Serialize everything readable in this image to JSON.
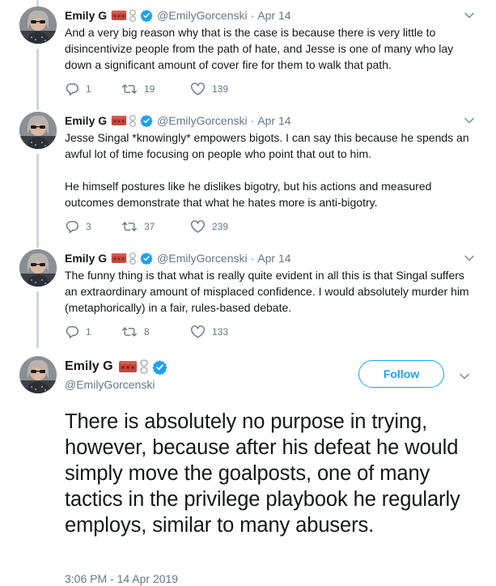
{
  "colors": {
    "accent": "#1da1f2",
    "muted": "#657786",
    "text": "#14171a",
    "thread_line": "#ccd6dd"
  },
  "icons": [
    "brick-icon",
    "chain-icon",
    "verified-badge-icon",
    "chevron-down-icon",
    "reply-icon",
    "retweet-icon",
    "like-icon"
  ],
  "thread": [
    {
      "name": "Emily G",
      "handle": "@EmilyGorcenski",
      "separator": "·",
      "date": "Apr 14",
      "paragraphs": [
        "And a very big reason why that is the case is because there is very little to disincentivize people from the path of hate, and Jesse is one of many who lay down a significant amount of cover fire for them to walk that path."
      ],
      "replies": "1",
      "retweets": "19",
      "likes": "139"
    },
    {
      "name": "Emily G",
      "handle": "@EmilyGorcenski",
      "separator": "·",
      "date": "Apr 14",
      "paragraphs": [
        "Jesse Singal *knowingly* empowers bigots. I can say this because he spends an awful lot of time focusing on people who point that out to him.",
        "He himself postures like he dislikes bigotry, but his actions and measured outcomes demonstrate that what he hates more is anti-bigotry."
      ],
      "replies": "3",
      "retweets": "37",
      "likes": "239"
    },
    {
      "name": "Emily G",
      "handle": "@EmilyGorcenski",
      "separator": "·",
      "date": "Apr 14",
      "paragraphs": [
        "The funny thing is that what is really quite evident in all this is that Singal suffers an extraordinary amount of misplaced confidence. I would absolutely murder him (metaphorically) in a fair, rules-based debate."
      ],
      "replies": "1",
      "retweets": "8",
      "likes": "133"
    }
  ],
  "main_tweet": {
    "name": "Emily G",
    "handle": "@EmilyGorcenski",
    "follow_label": "Follow",
    "text": "There is absolutely no purpose in trying, however, because after his defeat he would simply move the goalposts, one of many tactics in the privilege playbook he regularly employs, similar to many abusers.",
    "timestamp": "3:06 PM - 14 Apr 2019"
  }
}
